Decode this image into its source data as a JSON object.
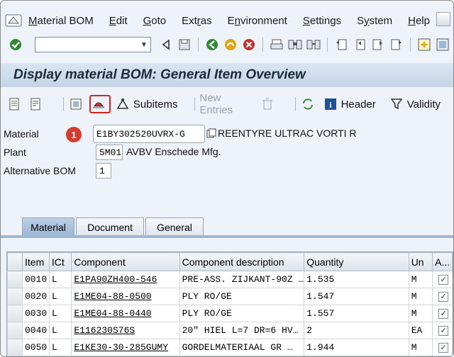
{
  "menu": {
    "items": [
      {
        "prefix": "",
        "u": "M",
        "rest": "aterial BOM"
      },
      {
        "prefix": "",
        "u": "E",
        "rest": "dit"
      },
      {
        "prefix": "",
        "u": "G",
        "rest": "oto"
      },
      {
        "prefix": "Ext",
        "u": "r",
        "rest": "as"
      },
      {
        "prefix": "E",
        "u": "n",
        "rest": "vironment"
      },
      {
        "prefix": "",
        "u": "S",
        "rest": "ettings"
      },
      {
        "prefix": "S",
        "u": "y",
        "rest": "stem"
      },
      {
        "prefix": "",
        "u": "H",
        "rest": "elp"
      }
    ]
  },
  "command_field": {
    "value": ""
  },
  "title": "Display material BOM: General Item Overview",
  "app_toolbar": {
    "subitems": "Subitems",
    "new_entries": "New Entries",
    "header": "Header",
    "validity": "Validity"
  },
  "form": {
    "material_label": "Material",
    "material_value": "E1BY302520UVRX-G",
    "material_desc": "REENTYRE  ULTRAC VORTI R",
    "badge": "1",
    "plant_label": "Plant",
    "plant_value": "5M01",
    "plant_desc": "AVBV Enschede Mfg.",
    "altbom_label": "Alternative BOM",
    "altbom_value": "1"
  },
  "tabs": [
    {
      "label": "Material"
    },
    {
      "label": "Document"
    },
    {
      "label": "General"
    }
  ],
  "table": {
    "headers": [
      "Item",
      "ICt",
      "Component",
      "Component description",
      "Quantity",
      "Un",
      "A..."
    ],
    "rows": [
      {
        "item": "0010",
        "ict": "L",
        "component": "E1PA90ZH400-546",
        "desc": "PRE-ASS. ZIJKANT-90Z …",
        "qty": "1.535",
        "un": "M"
      },
      {
        "item": "0020",
        "ict": "L",
        "component": "E1ME04-88-0500",
        "desc": "PLY RO/GE",
        "qty": "1.547",
        "un": "M"
      },
      {
        "item": "0030",
        "ict": "L",
        "component": "E1ME04-88-0440",
        "desc": "PLY RO/GE",
        "qty": "1.557",
        "un": "M"
      },
      {
        "item": "0040",
        "ict": "L",
        "component": "E116230S76S",
        "desc": "20\" HIEL  L=7 DR=6 HV…",
        "qty": "2",
        "un": "EA"
      },
      {
        "item": "0050",
        "ict": "L",
        "component": "E1KE30-30-285GUMY",
        "desc": "GORDELMATERIAAL GR …",
        "qty": "1.944",
        "un": "M"
      }
    ]
  },
  "colors": {
    "accent": "#d4251c",
    "title_bg": "#c4d4e6"
  }
}
